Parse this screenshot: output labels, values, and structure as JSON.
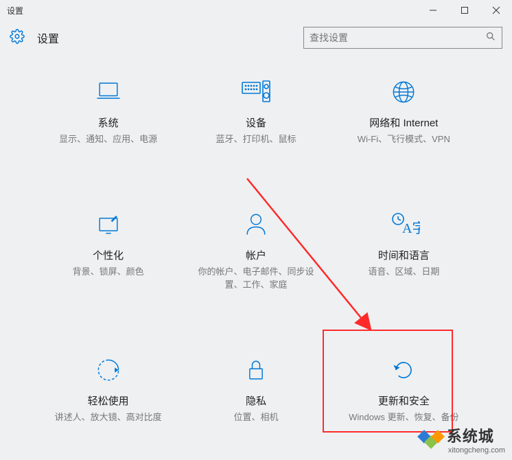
{
  "window": {
    "title": "设置"
  },
  "header": {
    "title": "设置"
  },
  "search": {
    "placeholder": "查找设置"
  },
  "tiles": [
    {
      "title": "系统",
      "subtitle": "显示、通知、应用、电源"
    },
    {
      "title": "设备",
      "subtitle": "蓝牙、打印机、鼠标"
    },
    {
      "title": "网络和 Internet",
      "subtitle": "Wi-Fi、飞行模式、VPN"
    },
    {
      "title": "个性化",
      "subtitle": "背景、锁屏、颜色"
    },
    {
      "title": "帐户",
      "subtitle": "你的帐户、电子邮件、同步设置、工作、家庭"
    },
    {
      "title": "时间和语言",
      "subtitle": "语音、区域、日期"
    },
    {
      "title": "轻松使用",
      "subtitle": "讲述人、放大镜、高对比度"
    },
    {
      "title": "隐私",
      "subtitle": "位置、相机"
    },
    {
      "title": "更新和安全",
      "subtitle": "Windows 更新、恢复、备份"
    }
  ],
  "watermark": {
    "brand": "系统城",
    "url": "xitongcheng.com"
  }
}
